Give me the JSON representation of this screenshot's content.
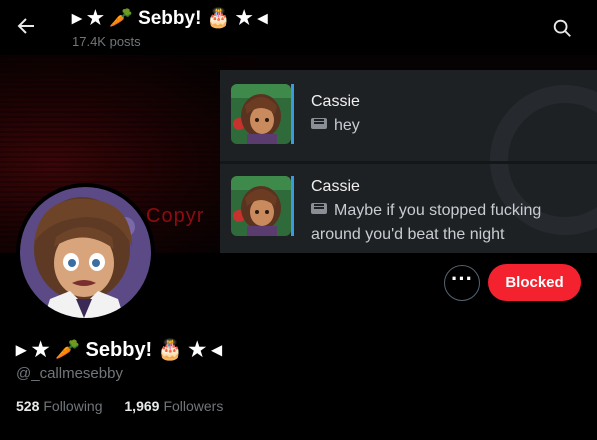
{
  "header": {
    "title": "▸ ★ 🥕 Sebby! 🎂 ★ ◂",
    "subtitle": "17.4K posts"
  },
  "banner": {
    "watermark": "Copyr",
    "messages": [
      {
        "name": "Cassie",
        "text": "hey"
      },
      {
        "name": "Cassie",
        "text_line1": "Maybe if you stopped fucking",
        "text_line2": "around you'd beat the night"
      }
    ]
  },
  "profile": {
    "display_name": "▸ ★ 🥕 Sebby! 🎂 ★ ◂",
    "handle": "@_callmesebby",
    "following_count": "528",
    "following_label": "Following",
    "followers_count": "1,969",
    "followers_label": "Followers"
  },
  "actions": {
    "more_label": "···",
    "blocked_label": "Blocked"
  },
  "colors": {
    "background": "#000000",
    "blocked_button": "#f4212e",
    "muted_text": "#71767b",
    "accent_bar": "#3a9bdc"
  },
  "icons": [
    "back-arrow-icon",
    "search-icon",
    "message-icon",
    "more-icon"
  ]
}
